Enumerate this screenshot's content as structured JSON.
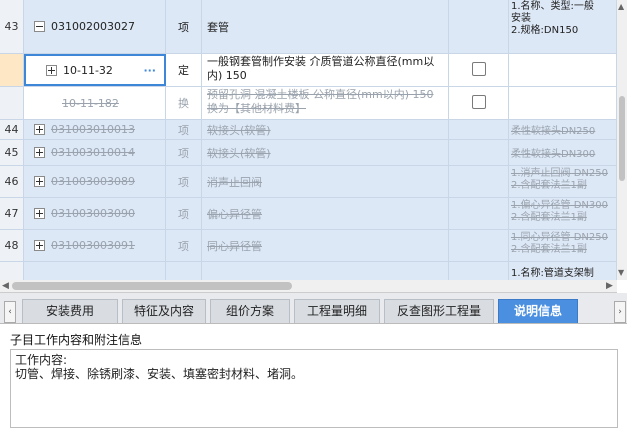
{
  "grid": {
    "top_row": {
      "code": "031002003027",
      "unit": "项",
      "name": "套管",
      "feature": "1.名称、类型:一般套管安装 2.规格:DN150",
      "feature_lines": [
        "1.名称、类型:一般",
        "安装",
        "2.规格:DN150"
      ],
      "number": "43"
    },
    "sub_row": {
      "code": "10-11-32",
      "more": "···",
      "unit": "定",
      "name": "一般钢套管制作安装 介质管道公称直径(mm以内) 150"
    },
    "replaced_row": {
      "code": "10-11-182",
      "unit": "换",
      "name": "预留孔洞 混凝土楼板 公称直径(mm以内) 150 换为【其他材料费】"
    },
    "rows": [
      {
        "number": "44",
        "code": "031003010013",
        "unit": "项",
        "name": "软接头(软管)",
        "feature_lines": [
          "柔性软接头DN250"
        ]
      },
      {
        "number": "45",
        "code": "031003010014",
        "unit": "项",
        "name": "软接头(软管)",
        "feature_lines": [
          "柔性软接头DN300"
        ]
      },
      {
        "number": "46",
        "code": "031003003089",
        "unit": "项",
        "name": "消声止回阀",
        "feature_lines": [
          "1.消声止回阀 DN250",
          "2.含配套法兰1副"
        ]
      },
      {
        "number": "47",
        "code": "031003003090",
        "unit": "项",
        "name": "偏心异径管",
        "feature_lines": [
          "1.偏心异径管 DN300",
          "2.含配套法兰1副"
        ]
      },
      {
        "number": "48",
        "code": "031003003091",
        "unit": "项",
        "name": "同心异径管",
        "feature_lines": [
          "1.同心异径管 DN250",
          "2.含配套法兰1副"
        ]
      }
    ],
    "bottom_partial_feature": "1.名称:管道支架制"
  },
  "tabs": [
    {
      "label": "安装费用",
      "active": false
    },
    {
      "label": "特征及内容",
      "active": false
    },
    {
      "label": "组价方案",
      "active": false
    },
    {
      "label": "工程量明细",
      "active": false
    },
    {
      "label": "反查图形工程量",
      "active": false
    },
    {
      "label": "说明信息",
      "active": true
    }
  ],
  "panel": {
    "title": "子目工作内容和附注信息",
    "content_line1": "工作内容:",
    "content_line2": "切管、焊接、除锈刷漆、安装、填塞密封材料、堵洞。"
  },
  "colors": {
    "row_blue": "#dde8f7",
    "tab_active": "#4a8fe0"
  }
}
